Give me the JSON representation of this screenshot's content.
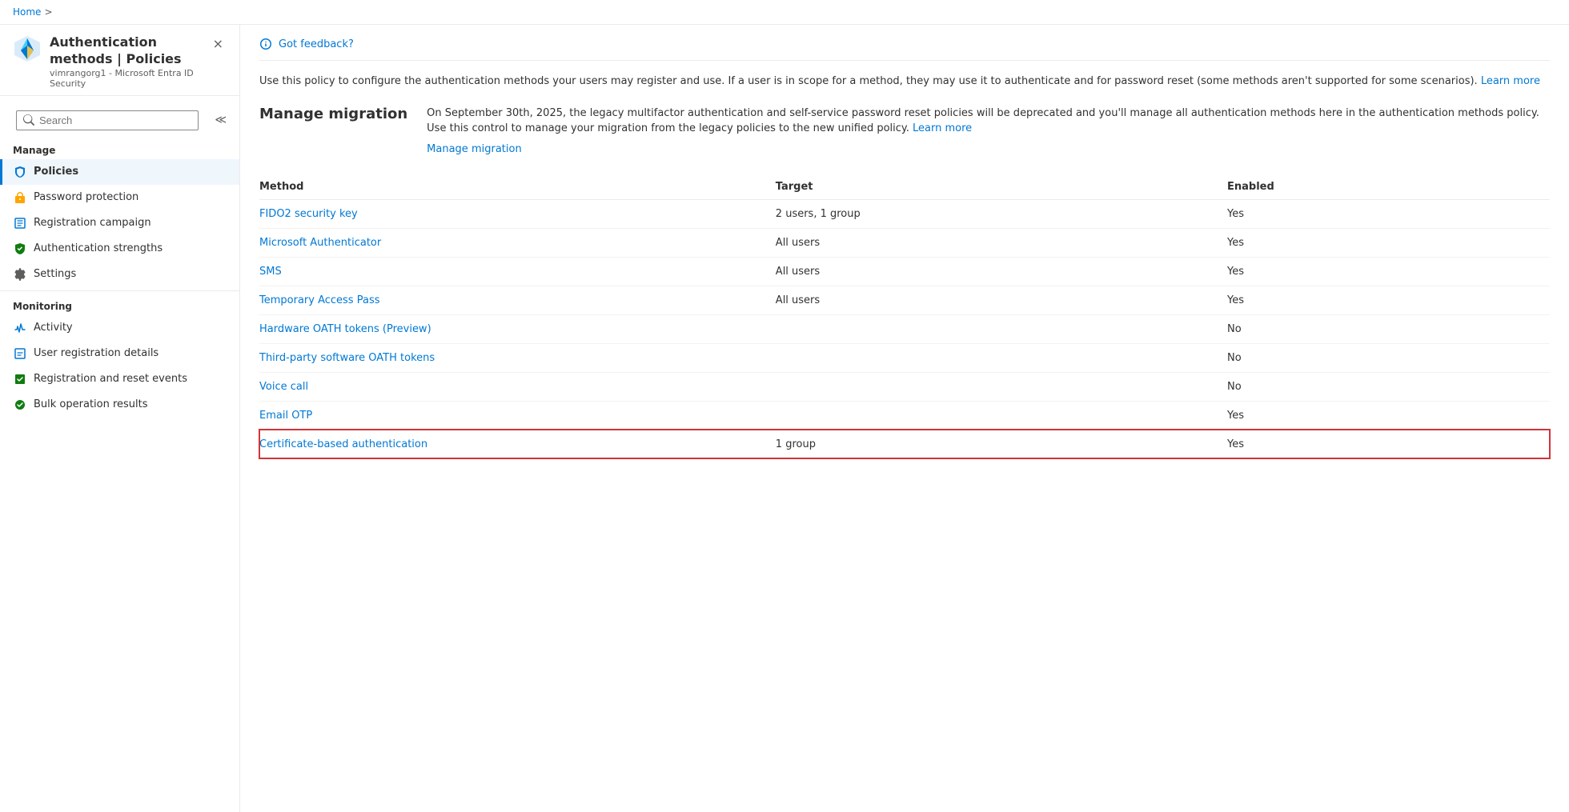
{
  "breadcrumb": {
    "home": "Home",
    "separator": ">"
  },
  "header": {
    "title": "Authentication methods | Policies",
    "more_options": "...",
    "subtitle": "vimrangorg1 - Microsoft Entra ID Security",
    "close_label": "×"
  },
  "search": {
    "placeholder": "Search"
  },
  "sidebar": {
    "manage_label": "Manage",
    "monitoring_label": "Monitoring",
    "items_manage": [
      {
        "id": "policies",
        "label": "Policies",
        "active": true,
        "icon": "policies-icon"
      },
      {
        "id": "password-protection",
        "label": "Password protection",
        "active": false,
        "icon": "password-icon"
      },
      {
        "id": "registration-campaign",
        "label": "Registration campaign",
        "active": false,
        "icon": "registration-icon"
      },
      {
        "id": "auth-strengths",
        "label": "Authentication strengths",
        "active": false,
        "icon": "auth-strength-icon"
      },
      {
        "id": "settings",
        "label": "Settings",
        "active": false,
        "icon": "settings-icon"
      }
    ],
    "items_monitoring": [
      {
        "id": "activity",
        "label": "Activity",
        "active": false,
        "icon": "activity-icon"
      },
      {
        "id": "user-registration",
        "label": "User registration details",
        "active": false,
        "icon": "user-reg-icon"
      },
      {
        "id": "reg-reset",
        "label": "Registration and reset events",
        "active": false,
        "icon": "reg-reset-icon"
      },
      {
        "id": "bulk-ops",
        "label": "Bulk operation results",
        "active": false,
        "icon": "bulk-icon"
      }
    ]
  },
  "main": {
    "feedback_label": "Got feedback?",
    "description": "Use this policy to configure the authentication methods your users may register and use. If a user is in scope for a method, they may use it to authenticate and for password reset (some methods aren't supported for some scenarios).",
    "learn_more_desc": "Learn more",
    "migration_title": "Manage migration",
    "migration_desc": "On September 30th, 2025, the legacy multifactor authentication and self-service password reset policies will be deprecated and you'll manage all authentication methods here in the authentication methods policy. Use this control to manage your migration from the legacy policies to the new unified policy.",
    "migration_learn_more": "Learn more",
    "manage_migration_link": "Manage migration",
    "table": {
      "headers": [
        "Method",
        "Target",
        "Enabled"
      ],
      "rows": [
        {
          "method": "FIDO2 security key",
          "target": "2 users, 1 group",
          "enabled": "Yes",
          "highlighted": false
        },
        {
          "method": "Microsoft Authenticator",
          "target": "All users",
          "enabled": "Yes",
          "highlighted": false
        },
        {
          "method": "SMS",
          "target": "All users",
          "enabled": "Yes",
          "highlighted": false
        },
        {
          "method": "Temporary Access Pass",
          "target": "All users",
          "enabled": "Yes",
          "highlighted": false
        },
        {
          "method": "Hardware OATH tokens (Preview)",
          "target": "",
          "enabled": "No",
          "highlighted": false
        },
        {
          "method": "Third-party software OATH tokens",
          "target": "",
          "enabled": "No",
          "highlighted": false
        },
        {
          "method": "Voice call",
          "target": "",
          "enabled": "No",
          "highlighted": false
        },
        {
          "method": "Email OTP",
          "target": "",
          "enabled": "Yes",
          "highlighted": false
        },
        {
          "method": "Certificate-based authentication",
          "target": "1 group",
          "enabled": "Yes",
          "highlighted": true
        }
      ]
    }
  }
}
